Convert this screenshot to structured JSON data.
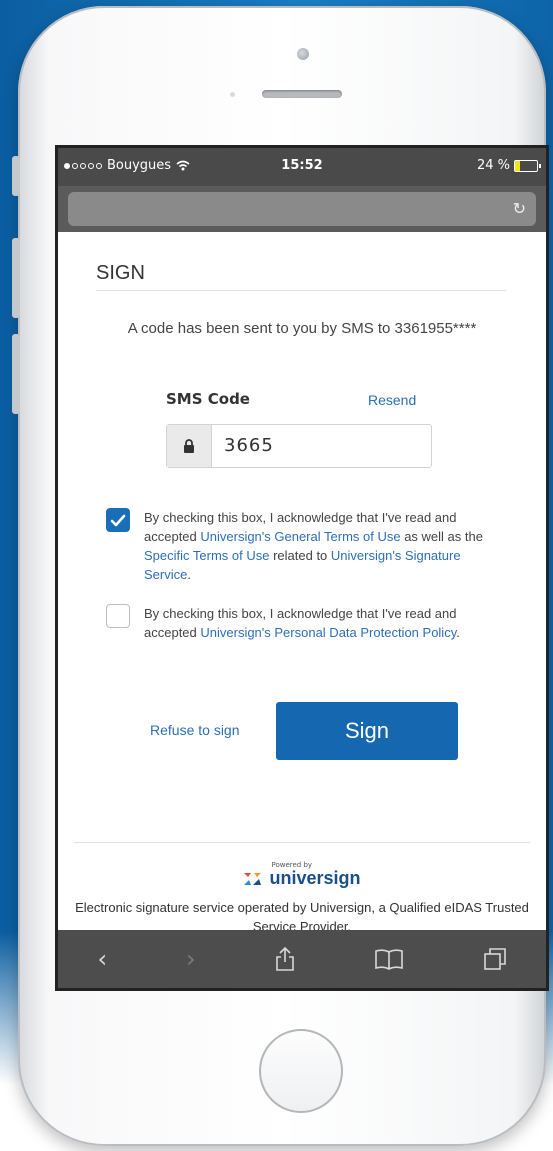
{
  "status_bar": {
    "carrier": "Bouygues",
    "wifi_icon": "wifi-icon",
    "time": "15:52",
    "battery_percent": "24 %",
    "battery_level": 0.24,
    "battery_color": "#f2e51a"
  },
  "address_bar": {
    "reload_icon": "reload-icon"
  },
  "page": {
    "title": "SIGN",
    "sms_message": "A code has been sent to you by SMS to 3361955****",
    "sms_label": "SMS Code",
    "resend": "Resend",
    "code_value": "3665",
    "terms": {
      "checked": true,
      "text_1": "By checking this box, I acknowledge that I've read and accepted ",
      "link_1": "Universign's General Terms of Use",
      "text_2": " as well as the ",
      "link_2": "Specific Terms of Use",
      "text_3": " related to ",
      "link_3": "Universign's Signature Service",
      "text_4": "."
    },
    "privacy": {
      "checked": false,
      "text_1": "By checking this box, I acknowledge that I've read and accepted ",
      "link_1": "Universign's Personal Data Protection Policy",
      "text_2": "."
    },
    "refuse": "Refuse to sign",
    "sign": "Sign"
  },
  "footer": {
    "powered_by": "Powered by",
    "brand": "universign",
    "text": "Electronic signature service operated by Universign, a Qualified eIDAS Trusted Service Provider."
  },
  "colors": {
    "primary": "#1567af",
    "link": "#2c6fb8"
  }
}
